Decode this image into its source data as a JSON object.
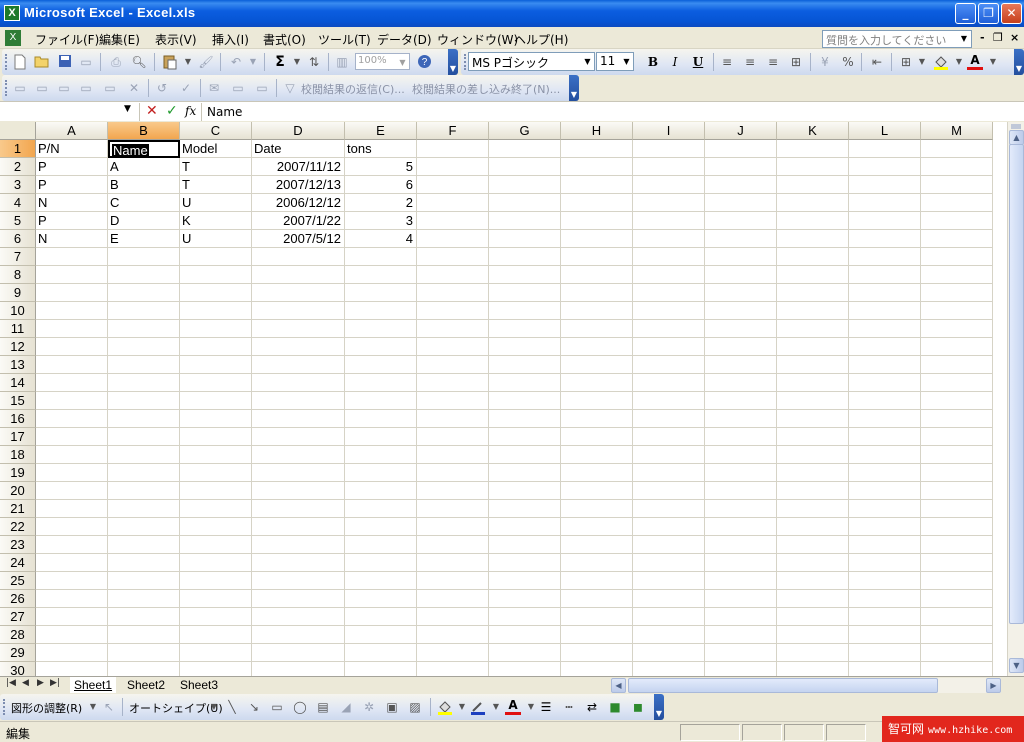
{
  "window": {
    "title": "Microsoft Excel - Excel.xls",
    "app_icon_glyph": "X",
    "buttons": {
      "minimize": "_",
      "restore": "❐",
      "close": "✕"
    }
  },
  "menu": {
    "items": [
      "ファイル(F)",
      "編集(E)",
      "表示(V)",
      "挿入(I)",
      "書式(O)",
      "ツール(T)",
      "データ(D)",
      "ウィンドウ(W)",
      "ヘルプ(H)"
    ],
    "help_placeholder": "質問を入力してください",
    "mdi_buttons": [
      "-",
      "❐",
      "×"
    ]
  },
  "standard_toolbar": {
    "zoom": "100%"
  },
  "format_toolbar": {
    "font_name": "MS Pゴシック",
    "font_size": "11",
    "bold": "B",
    "italic": "I",
    "underline": "U",
    "font_color_letter": "A",
    "font_color": "#e01010",
    "fill_color": "#ffff00"
  },
  "review_toolbar": {
    "reply_label": "校閲結果の返信(C)...",
    "end_review_label": "校閲結果の差し込み終了(N)..."
  },
  "formula_bar": {
    "name_box": "",
    "cancel": "✕",
    "enter": "✓",
    "fx": "fx",
    "content": "Name"
  },
  "grid": {
    "columns": [
      "A",
      "B",
      "C",
      "D",
      "E",
      "F",
      "G",
      "H",
      "I",
      "J",
      "K",
      "L",
      "M"
    ],
    "rows": [
      "1",
      "2",
      "3",
      "4",
      "5",
      "6",
      "7",
      "8",
      "9",
      "10",
      "11",
      "12",
      "13",
      "14",
      "15",
      "16",
      "17",
      "18",
      "19",
      "20",
      "21",
      "22",
      "23",
      "24",
      "25",
      "26",
      "27",
      "28",
      "29",
      "30"
    ],
    "selected_column": "B",
    "selected_row": "1",
    "active_cell": "B1",
    "data": [
      [
        "P/N",
        "Name",
        "Model",
        "Date",
        "tons"
      ],
      [
        "P",
        "A",
        "T",
        "2007/11/12",
        "5"
      ],
      [
        "P",
        "B",
        "T",
        "2007/12/13",
        "6"
      ],
      [
        "N",
        "C",
        "U",
        "2006/12/12",
        "2"
      ],
      [
        "P",
        "D",
        "K",
        "2007/1/22",
        "3"
      ],
      [
        "N",
        "E",
        "U",
        "2007/5/12",
        "4"
      ]
    ]
  },
  "sheets": {
    "tabs": [
      "Sheet1",
      "Sheet2",
      "Sheet3"
    ],
    "active": "Sheet1"
  },
  "drawing_toolbar": {
    "draw_menu": "図形の調整(R)",
    "autoshapes_menu": "オートシェイプ(U)"
  },
  "status": {
    "mode": "編集"
  },
  "watermark": {
    "brand": "智可网",
    "url": "www.hzhike.com"
  }
}
